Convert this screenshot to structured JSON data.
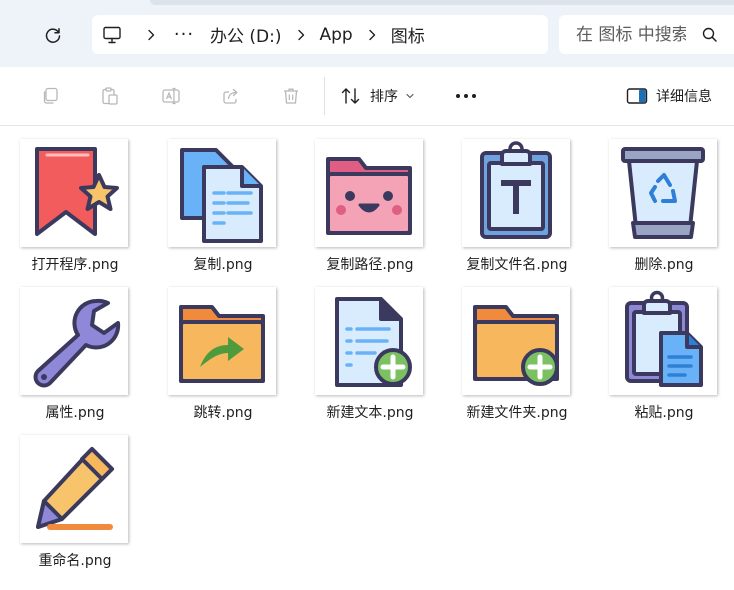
{
  "addressbar": {
    "more_label": "···",
    "breadcrumbs": [
      "办公 (D:)",
      "App",
      "图标"
    ],
    "search_placeholder": "在 图标 中搜索"
  },
  "toolbar": {
    "sort_label": "排序",
    "details_label": "详细信息"
  },
  "files": [
    {
      "name": "打开程序.png",
      "icon": "bookmark-star-icon"
    },
    {
      "name": "复制.png",
      "icon": "copy-documents-icon"
    },
    {
      "name": "复制路径.png",
      "icon": "smiling-folder-icon"
    },
    {
      "name": "复制文件名.png",
      "icon": "clipboard-text-icon"
    },
    {
      "name": "删除.png",
      "icon": "recycle-bin-icon"
    },
    {
      "name": "属性.png",
      "icon": "wrench-icon"
    },
    {
      "name": "跳转.png",
      "icon": "folder-arrow-icon"
    },
    {
      "name": "新建文本.png",
      "icon": "new-document-icon"
    },
    {
      "name": "新建文件夹.png",
      "icon": "new-folder-icon"
    },
    {
      "name": "粘贴.png",
      "icon": "paste-clipboard-icon"
    },
    {
      "name": "重命名.png",
      "icon": "pencil-icon"
    }
  ],
  "colors": {
    "outline": "#3b3a5e",
    "red": "#f25c5c",
    "yellow": "#f7c46b",
    "blue": "#6ab2f7",
    "light_blue": "#d8ecfd",
    "pink": "#f4a3b7",
    "folder_orange": "#f7b75c",
    "green": "#7bc162",
    "purple": "#8f88d8",
    "toolbar_disabled": "#b7b7b7",
    "address_bg": "#eef3f9"
  }
}
